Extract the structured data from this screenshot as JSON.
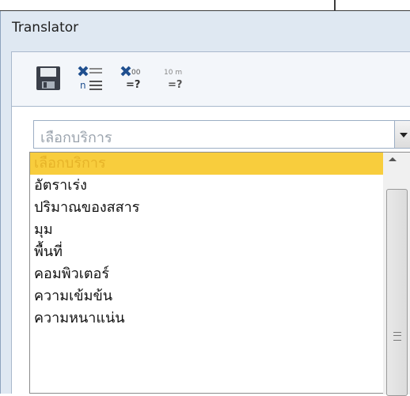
{
  "window": {
    "title": "Translator"
  },
  "toolbar": [
    {
      "name": "save-icon"
    },
    {
      "name": "clear-list-icon"
    },
    {
      "name": "clear-values-icon",
      "label_top": "00",
      "label_bottom": "=?"
    },
    {
      "name": "convert-icon",
      "label_top": "10 m",
      "label_bottom": "=?"
    }
  ],
  "service_select": {
    "value": "เลือกบริการ"
  },
  "service_options": [
    "เลือกบริการ",
    "อัตราเร่ง",
    "ปริมาณของสสาร",
    "มุม",
    "พื้นที่",
    "คอมพิวเตอร์",
    "ความเข้มข้น",
    "ความหนาแน่น"
  ],
  "colors": {
    "highlight": "#f8cd3d",
    "accent": "#1f4f8f"
  }
}
